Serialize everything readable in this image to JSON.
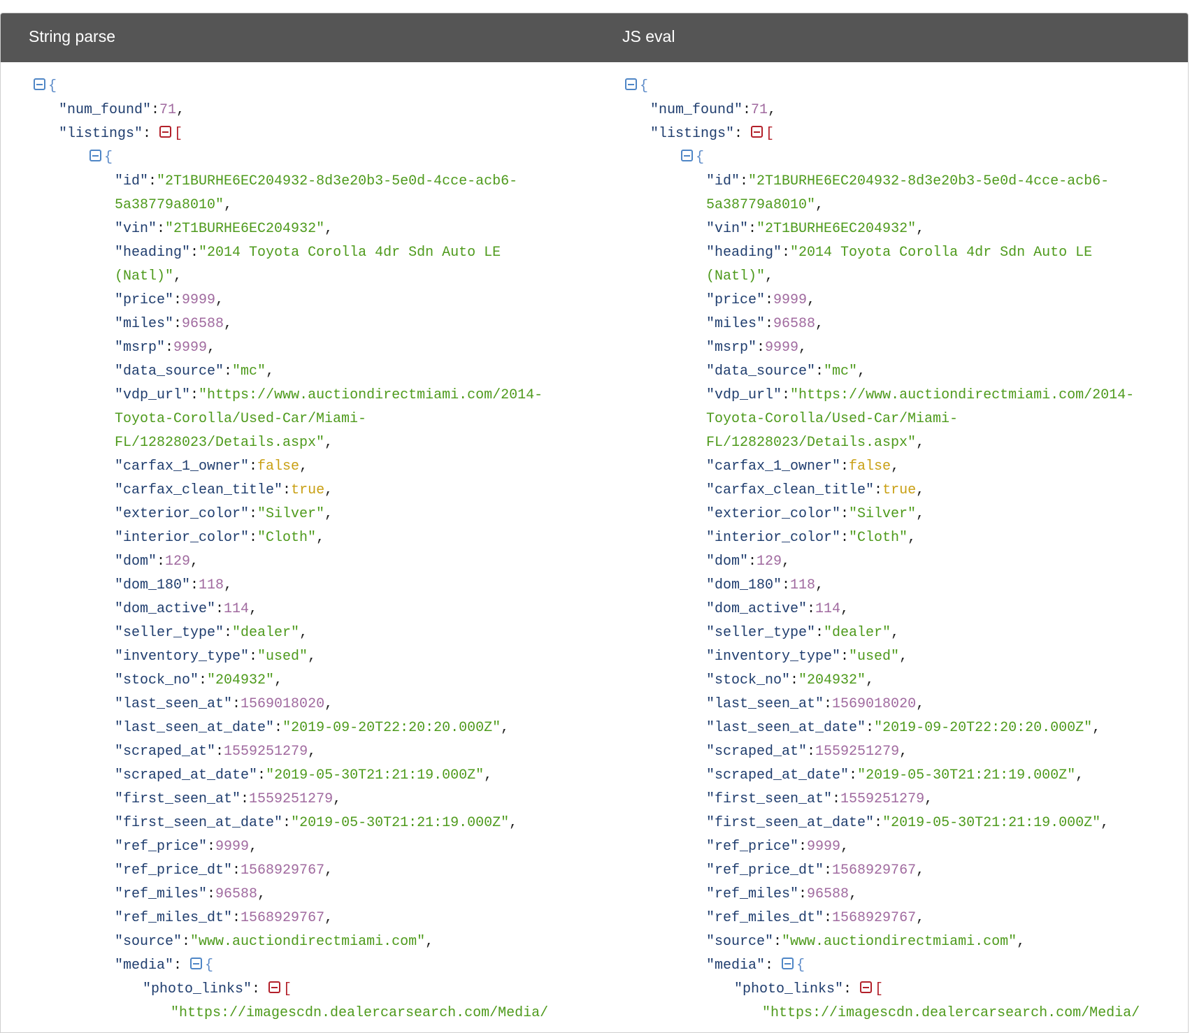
{
  "header": {
    "left_title": "String parse",
    "right_title": "JS eval"
  },
  "open_brace": "{",
  "open_bracket": "[",
  "json": {
    "k_num_found": "\"num_found\"",
    "v_num_found": "71",
    "k_listings": "\"listings\"",
    "k_id": "\"id\"",
    "v_id_1": "\"2T1BURHE6EC204932-8d3e20b3-5e0d-4cce-acb6-",
    "v_id_2": "5a38779a8010\"",
    "k_vin": "\"vin\"",
    "v_vin": "\"2T1BURHE6EC204932\"",
    "k_heading": "\"heading\"",
    "v_heading_1": "\"2014 Toyota Corolla 4dr Sdn Auto LE",
    "v_heading_2": "(Natl)\"",
    "k_price": "\"price\"",
    "v_price": "9999",
    "k_miles": "\"miles\"",
    "v_miles": "96588",
    "k_msrp": "\"msrp\"",
    "v_msrp": "9999",
    "k_data_source": "\"data_source\"",
    "v_data_source": "\"mc\"",
    "k_vdp_url": "\"vdp_url\"",
    "v_vdp_url_1": "\"https://www.auctiondirectmiami.com/2014-",
    "v_vdp_url_2": "Toyota-Corolla/Used-Car/Miami-",
    "v_vdp_url_3": "FL/12828023/Details.aspx\"",
    "k_carfax_1_owner": "\"carfax_1_owner\"",
    "v_carfax_1_owner": "false",
    "k_carfax_clean_title": "\"carfax_clean_title\"",
    "v_carfax_clean_title": "true",
    "k_exterior_color": "\"exterior_color\"",
    "v_exterior_color": "\"Silver\"",
    "k_interior_color": "\"interior_color\"",
    "v_interior_color": "\"Cloth\"",
    "k_dom": "\"dom\"",
    "v_dom": "129",
    "k_dom_180": "\"dom_180\"",
    "v_dom_180": "118",
    "k_dom_active": "\"dom_active\"",
    "v_dom_active": "114",
    "k_seller_type": "\"seller_type\"",
    "v_seller_type": "\"dealer\"",
    "k_inventory_type": "\"inventory_type\"",
    "v_inventory_type": "\"used\"",
    "k_stock_no": "\"stock_no\"",
    "v_stock_no": "\"204932\"",
    "k_last_seen_at": "\"last_seen_at\"",
    "v_last_seen_at": "1569018020",
    "k_last_seen_at_date": "\"last_seen_at_date\"",
    "v_last_seen_at_date": "\"2019-09-20T22:20:20.000Z\"",
    "k_scraped_at": "\"scraped_at\"",
    "v_scraped_at": "1559251279",
    "k_scraped_at_date": "\"scraped_at_date\"",
    "v_scraped_at_date": "\"2019-05-30T21:21:19.000Z\"",
    "k_first_seen_at": "\"first_seen_at\"",
    "v_first_seen_at": "1559251279",
    "k_first_seen_at_date": "\"first_seen_at_date\"",
    "v_first_seen_at_date": "\"2019-05-30T21:21:19.000Z\"",
    "k_ref_price": "\"ref_price\"",
    "v_ref_price": "9999",
    "k_ref_price_dt": "\"ref_price_dt\"",
    "v_ref_price_dt": "1568929767",
    "k_ref_miles": "\"ref_miles\"",
    "v_ref_miles": "96588",
    "k_ref_miles_dt": "\"ref_miles_dt\"",
    "v_ref_miles_dt": "1568929767",
    "k_source": "\"source\"",
    "v_source": "\"www.auctiondirectmiami.com\"",
    "k_media": "\"media\"",
    "k_photo_links": "\"photo_links\"",
    "v_photo_partial": "\"https://imagescdn.dealercarsearch.com/Media/"
  },
  "colors": {
    "header_bg": "#555555",
    "key": "#1f3d6e",
    "string": "#4e9a1c",
    "number": "#a06a9f",
    "boolean": "#c9a014",
    "toggle_blue": "#4f86c6",
    "toggle_red": "#b3202a"
  }
}
